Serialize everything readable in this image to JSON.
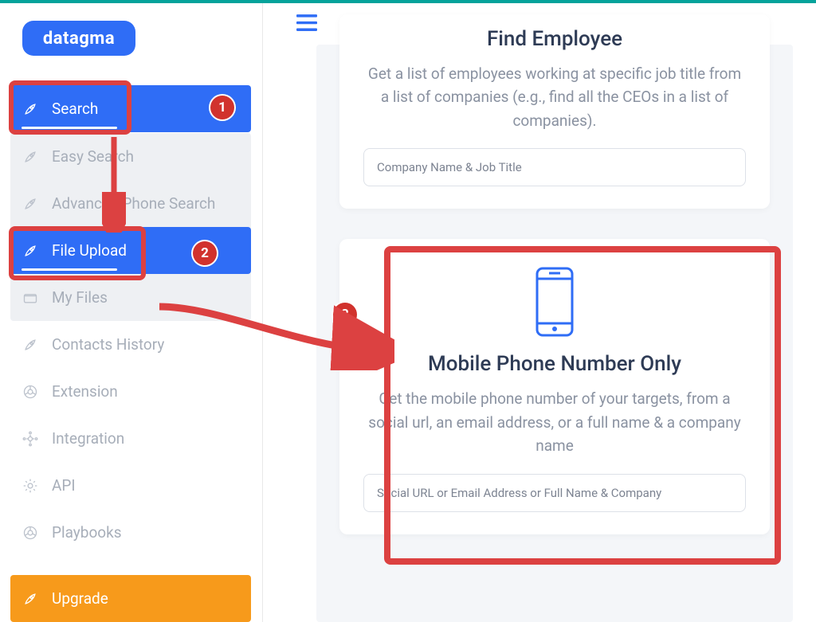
{
  "brand": {
    "name": "datagma"
  },
  "sidebar": {
    "items": [
      {
        "label": "Search",
        "icon": "rocket-icon",
        "active": true
      },
      {
        "label": "Easy Search",
        "icon": "rocket-icon",
        "active": false,
        "sub": true
      },
      {
        "label": "Advanced Phone Search",
        "icon": "rocket-icon",
        "active": false,
        "sub": true
      },
      {
        "label": "File Upload",
        "icon": "rocket-icon",
        "active": true,
        "sub": true
      },
      {
        "label": "My Files",
        "icon": "folder-icon",
        "active": false,
        "sub": true
      },
      {
        "label": "Contacts History",
        "icon": "rocket-icon",
        "active": false
      },
      {
        "label": "Extension",
        "icon": "chrome-icon",
        "active": false
      },
      {
        "label": "Integration",
        "icon": "hub-icon",
        "active": false
      },
      {
        "label": "API",
        "icon": "gear-icon",
        "active": false
      },
      {
        "label": "Playbooks",
        "icon": "chrome-icon",
        "active": false
      }
    ],
    "upgrade_label": "Upgrade"
  },
  "main": {
    "card1": {
      "title": "Find Employee",
      "desc": "Get a list of employees working at specific job title from a list of companies (e.g., find all the CEOs in a list of companies).",
      "placeholder": "Company Name & Job Title"
    },
    "card2": {
      "title": "Mobile Phone Number Only",
      "desc": "Get the mobile phone number of your targets, from a social url, an email address, or a full name & a company name",
      "placeholder": "Social URL or Email Address or Full Name & Company"
    }
  },
  "annotations": {
    "badge1": "1",
    "badge2": "2",
    "badge3": "3"
  }
}
